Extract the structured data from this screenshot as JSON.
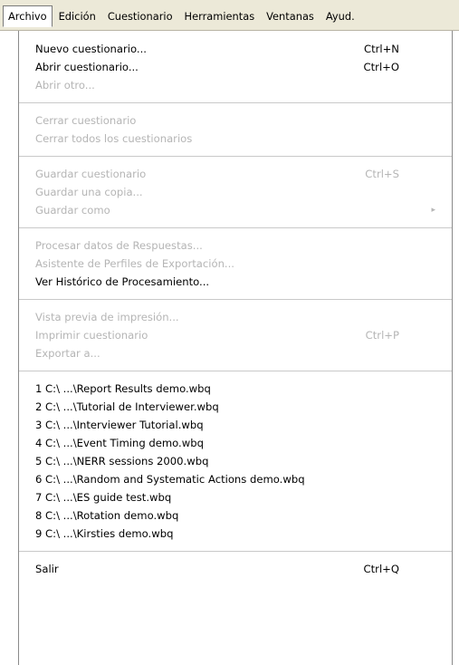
{
  "menubar": {
    "items": [
      "Archivo",
      "Edición",
      "Cuestionario",
      "Herramientas",
      "Ventanas",
      "Ayud."
    ]
  },
  "menu": {
    "new": {
      "label": "Nuevo cuestionario...",
      "shortcut": "Ctrl+N"
    },
    "open": {
      "label": "Abrir cuestionario...",
      "shortcut": "Ctrl+O"
    },
    "open_other": {
      "label": "Abrir otro..."
    },
    "close": {
      "label": "Cerrar cuestionario"
    },
    "close_all": {
      "label": "Cerrar todos los cuestionarios"
    },
    "save": {
      "label": "Guardar cuestionario",
      "shortcut": "Ctrl+S"
    },
    "save_copy": {
      "label": "Guardar una copia..."
    },
    "save_as": {
      "label": "Guardar como",
      "submenu_icon": "chevron-right-icon"
    },
    "process": {
      "label": "Procesar datos de Respuestas..."
    },
    "export_wizard": {
      "label": "Asistente de Perfiles de Exportación..."
    },
    "history": {
      "label": "Ver Histórico de Procesamiento..."
    },
    "print_preview": {
      "label": "Vista previa de impresión..."
    },
    "print": {
      "label": "Imprimir cuestionario",
      "shortcut": "Ctrl+P"
    },
    "export": {
      "label": "Exportar a..."
    },
    "recent": [
      "1 C:\\ ...\\Report Results demo.wbq",
      "2 C:\\ ...\\Tutorial de Interviewer.wbq",
      "3 C:\\ ...\\Interviewer Tutorial.wbq",
      "4 C:\\ ...\\Event Timing demo.wbq",
      "5 C:\\ ...\\NERR sessions 2000.wbq",
      "6 C:\\ ...\\Random and Systematic Actions demo.wbq",
      "7 C:\\ ...\\ES guide test.wbq",
      "8 C:\\ ...\\Rotation demo.wbq",
      "9 C:\\ ...\\Kirsties demo.wbq"
    ],
    "exit": {
      "label": "Salir",
      "shortcut": "Ctrl+Q"
    }
  },
  "colors": {
    "enabled_text": "#000000",
    "disabled_text": "#b5b5b5",
    "menubar_bg": "#ece9d8"
  }
}
